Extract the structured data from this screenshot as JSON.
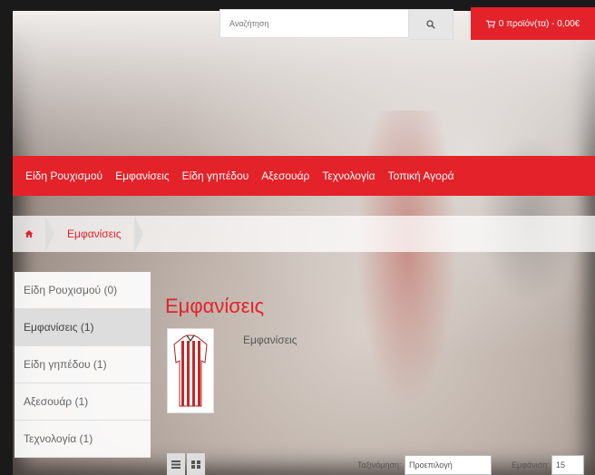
{
  "header": {
    "search_placeholder": "Αναζήτηση",
    "cart_label": "0 προϊόν(τα) - 0,00€"
  },
  "nav": {
    "items": [
      {
        "label": "Είδη Ρουχισμού"
      },
      {
        "label": "Εμφανίσεις"
      },
      {
        "label": "Είδη γηπέδου"
      },
      {
        "label": "Αξεσουάρ"
      },
      {
        "label": "Τεχνολογία"
      },
      {
        "label": "Τοπική Αγορά"
      }
    ]
  },
  "breadcrumb": {
    "current": "Εμφανίσεις"
  },
  "sidebar": {
    "items": [
      {
        "label": "Είδη Ρουχισμού (0)",
        "active": false
      },
      {
        "label": "Εμφανίσεις (1)",
        "active": true
      },
      {
        "label": "Είδη γηπέδου (1)",
        "active": false
      },
      {
        "label": "Αξεσουάρ (1)",
        "active": false
      },
      {
        "label": "Τεχνολογία (1)",
        "active": false
      }
    ]
  },
  "category": {
    "title": "Εμφανίσεις",
    "description": "Εμφανίσεις"
  },
  "toolbar": {
    "sort_label": "Ταξινόμηση:",
    "sort_value": "Προεπιλογή",
    "show_label": "Εμφάνιση:",
    "show_value": "15"
  },
  "colors": {
    "accent": "#e32229"
  }
}
